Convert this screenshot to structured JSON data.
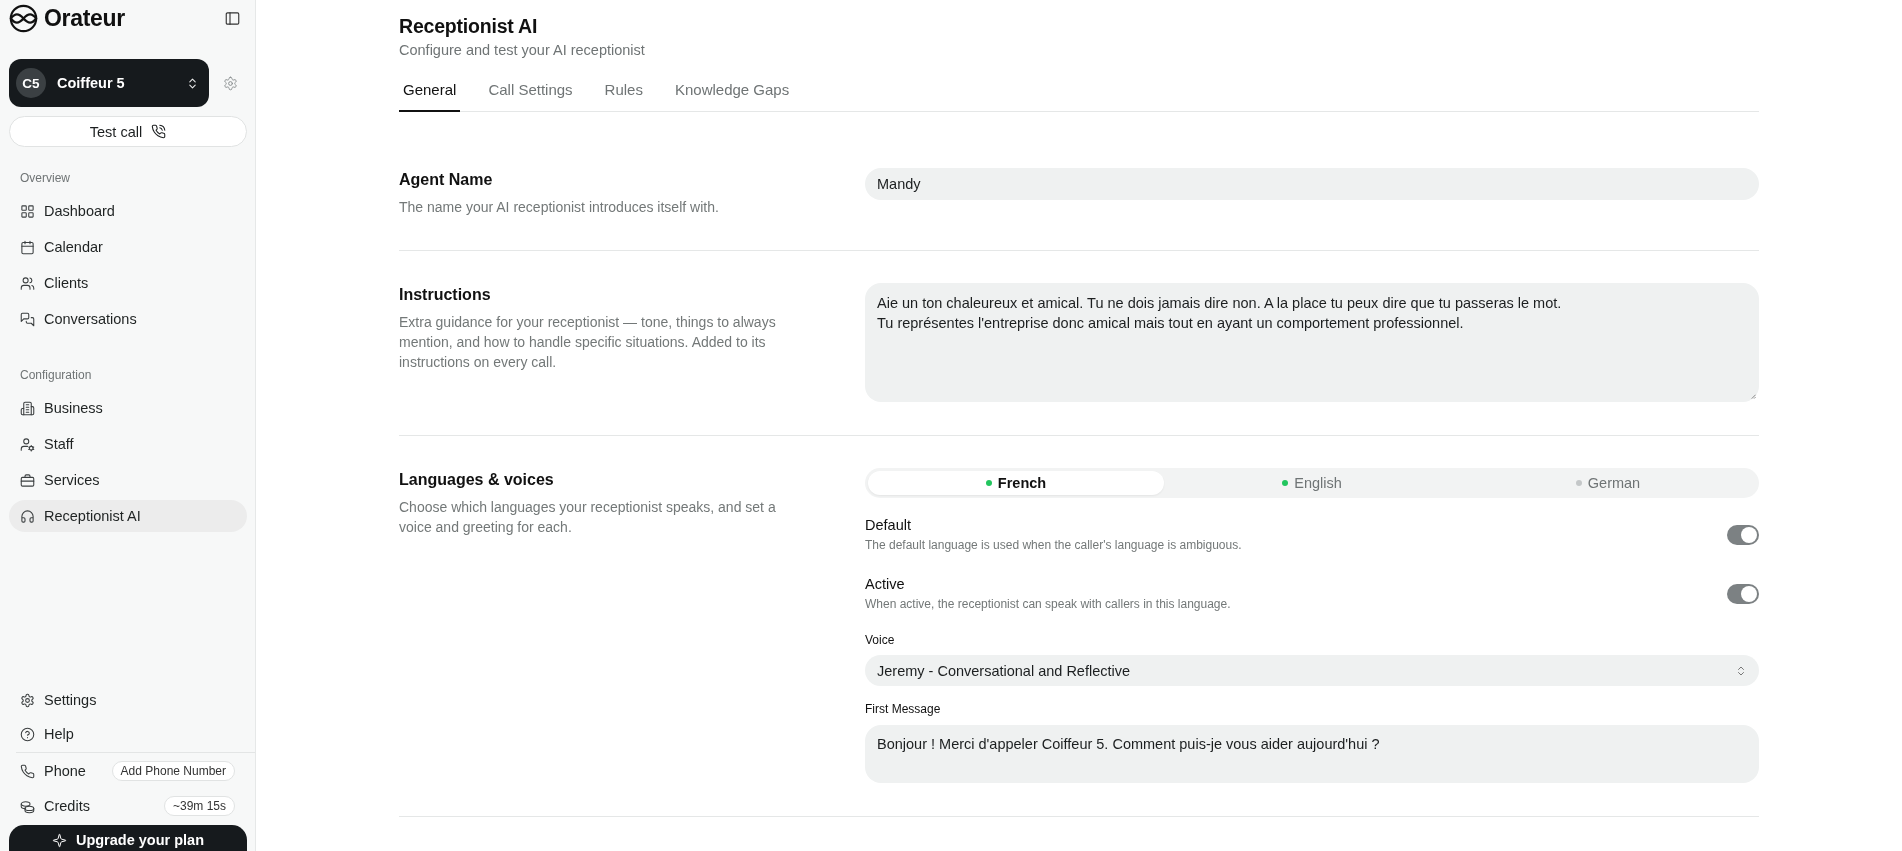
{
  "sidebar": {
    "logo": "Orateur",
    "workspace": {
      "initials": "C5",
      "name": "Coiffeur 5"
    },
    "test_call": "Test call",
    "groups": [
      {
        "title": "Overview",
        "items": [
          {
            "label": "Dashboard",
            "selected": false
          },
          {
            "label": "Calendar",
            "selected": false
          },
          {
            "label": "Clients",
            "selected": false
          },
          {
            "label": "Conversations",
            "selected": false
          }
        ]
      },
      {
        "title": "Configuration",
        "items": [
          {
            "label": "Business",
            "selected": false
          },
          {
            "label": "Staff",
            "selected": false
          },
          {
            "label": "Services",
            "selected": false
          },
          {
            "label": "Receptionist AI",
            "selected": true
          }
        ]
      }
    ],
    "footer_items": [
      {
        "label": "Settings",
        "selected": false
      },
      {
        "label": "Help",
        "selected": false
      }
    ],
    "phone": {
      "label": "Phone",
      "action": "Add Phone Number"
    },
    "credits": {
      "label": "Credits",
      "value": "~39m 15s"
    },
    "upgrade": "Upgrade your plan"
  },
  "header": {
    "title": "Receptionist AI",
    "subtitle": "Configure and test your AI receptionist",
    "tabs": [
      {
        "label": "General",
        "selected": true
      },
      {
        "label": "Call Settings",
        "selected": false
      },
      {
        "label": "Rules",
        "selected": false
      },
      {
        "label": "Knowledge Gaps",
        "selected": false
      }
    ]
  },
  "sections": [
    {
      "kind": "input",
      "title": "Agent Name",
      "description": "The name your AI receptionist introduces itself with.",
      "value": "Mandy"
    },
    {
      "kind": "textarea",
      "title": "Instructions",
      "description": "Extra guidance for your receptionist — tone, things to always mention, and how to handle specific situations. Added to its instructions on every call.",
      "value": "Aie un ton chaleureux et amical. Tu ne dois jamais dire non. A la place tu peux dire que tu passeras le mot.\nTu représentes l'entreprise donc amical mais tout en ayant un comportement professionnel."
    },
    {
      "kind": "languages",
      "title": "Languages & voices",
      "description": "Choose which languages your receptionist speaks, and set a voice and greeting for each.",
      "languages": [
        {
          "label": "French",
          "selected": true,
          "color": "#22c55e"
        },
        {
          "label": "English",
          "selected": false,
          "color": "#22c55e"
        },
        {
          "label": "German",
          "selected": false,
          "color": "#c4c7c8"
        }
      ],
      "toggles": [
        {
          "label": "Default",
          "description": "The default language is used when the caller's language is ambiguous.",
          "on": true
        },
        {
          "label": "Active",
          "description": "When active, the receptionist can speak with callers in this language.",
          "on": true
        }
      ],
      "voice": {
        "label": "Voice",
        "value": "Jeremy - Conversational and Reflective"
      },
      "first_message": {
        "label": "First Message",
        "value": "Bonjour ! Merci d'appeler Coiffeur 5. Comment puis-je vous aider aujourd'hui ?"
      }
    }
  ]
}
